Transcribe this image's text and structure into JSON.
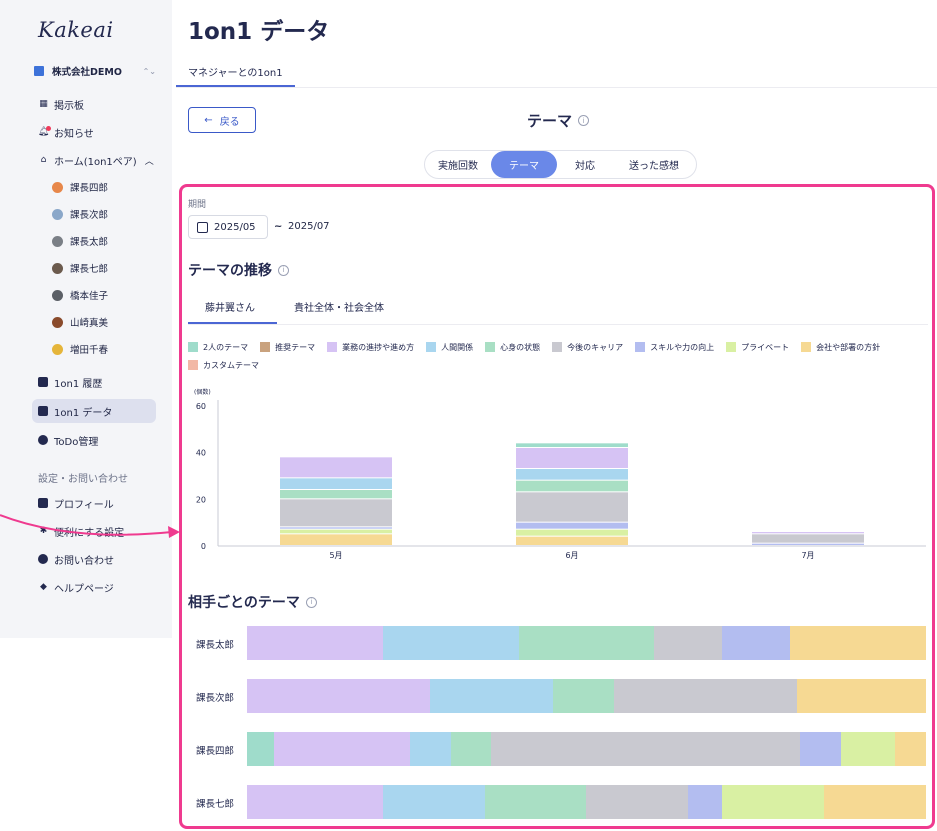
{
  "app": {
    "logo": "Kakeai",
    "company": "株式会社DEMO"
  },
  "sidebar": {
    "items": [
      {
        "label": "掲示板",
        "icon": "bulletin-icon"
      },
      {
        "label": "お知らせ",
        "icon": "bell-icon"
      },
      {
        "label": "ホーム(1on1ペア)",
        "icon": "home-icon"
      }
    ],
    "members": [
      "課長四郎",
      "課長次郎",
      "課長太郎",
      "課長七郎",
      "橋本佳子",
      "山崎真美",
      "増田千春"
    ],
    "items2": [
      {
        "label": "1on1 履歴",
        "icon": "history-icon"
      },
      {
        "label": "1on1 データ",
        "icon": "data-icon"
      },
      {
        "label": "ToDo管理",
        "icon": "check-icon"
      }
    ],
    "settings_label": "設定・お問い合わせ",
    "settings": [
      {
        "label": "プロフィール",
        "icon": "profile-icon"
      },
      {
        "label": "便利にする設定",
        "icon": "gear-icon"
      },
      {
        "label": "お問い合わせ",
        "icon": "help-icon"
      },
      {
        "label": "ヘルプページ",
        "icon": "graduation-icon"
      }
    ]
  },
  "header": {
    "title": "1on1 データ",
    "tab": "マネジャーとの1on1"
  },
  "view": {
    "back_label": "戻る",
    "title": "テーマ",
    "segments": [
      "実施回数",
      "テーマ",
      "対応",
      "送った感想"
    ],
    "active_segment": "テーマ"
  },
  "period": {
    "label": "期間",
    "start": "2025/05",
    "separator": "~",
    "end": "2025/07"
  },
  "trend": {
    "title": "テーマの推移",
    "tabs": [
      "藤井翼さん",
      "貴社全体・社会全体"
    ]
  },
  "colors": {
    "2人のテーマ": "#9fdccb",
    "推奨テーマ": "#c9a27e",
    "業務の進捗や進め方": "#d6c3f4",
    "人間関係": "#a9d6ef",
    "心身の状態": "#a9dfc4",
    "今後のキャリア": "#c9c9d0",
    "スキルや力の向上": "#b3bdf0",
    "プライベート": "#d9f0a3",
    "会社や部署の方針": "#f6d993",
    "カスタムテーマ": "#f2b8a5"
  },
  "chart_data": {
    "type": "bar",
    "stacked": true,
    "ylabel": "(個数)",
    "ylim": [
      0,
      60
    ],
    "yticks": [
      0,
      20,
      40,
      60
    ],
    "categories": [
      "5月",
      "6月",
      "7月"
    ],
    "legend": [
      "2人のテーマ",
      "推奨テーマ",
      "業務の進捗や進め方",
      "人間関係",
      "心身の状態",
      "今後のキャリア",
      "スキルや力の向上",
      "プライベート",
      "会社や部署の方針",
      "カスタムテーマ"
    ],
    "series": [
      {
        "name": "会社や部署の方針",
        "values": [
          5,
          4,
          0
        ]
      },
      {
        "name": "プライベート",
        "values": [
          2,
          3,
          0
        ]
      },
      {
        "name": "スキルや力の向上",
        "values": [
          1,
          3,
          1
        ]
      },
      {
        "name": "今後のキャリア",
        "values": [
          12,
          13,
          4
        ]
      },
      {
        "name": "心身の状態",
        "values": [
          4,
          5,
          0
        ]
      },
      {
        "name": "人間関係",
        "values": [
          5,
          5,
          0
        ]
      },
      {
        "name": "業務の進捗や進め方",
        "values": [
          9,
          9,
          1
        ]
      },
      {
        "name": "2人のテーマ",
        "values": [
          0,
          2,
          0
        ]
      }
    ]
  },
  "by_person": {
    "title": "相手ごとのテーマ",
    "rows": [
      {
        "name": "課長太郎",
        "segments": [
          {
            "theme": "業務の進捗や進め方",
            "share": 0.2
          },
          {
            "theme": "人間関係",
            "share": 0.2
          },
          {
            "theme": "心身の状態",
            "share": 0.2
          },
          {
            "theme": "今後のキャリア",
            "share": 0.1
          },
          {
            "theme": "スキルや力の向上",
            "share": 0.1
          },
          {
            "theme": "会社や部署の方針",
            "share": 0.2
          }
        ]
      },
      {
        "name": "課長次郎",
        "segments": [
          {
            "theme": "業務の進捗や進め方",
            "share": 0.27
          },
          {
            "theme": "人間関係",
            "share": 0.18
          },
          {
            "theme": "心身の状態",
            "share": 0.09
          },
          {
            "theme": "今後のキャリア",
            "share": 0.27
          },
          {
            "theme": "会社や部署の方針",
            "share": 0.19
          }
        ]
      },
      {
        "name": "課長四郎",
        "segments": [
          {
            "theme": "2人のテーマ",
            "share": 0.04
          },
          {
            "theme": "業務の進捗や進め方",
            "share": 0.2
          },
          {
            "theme": "人間関係",
            "share": 0.06
          },
          {
            "theme": "心身の状態",
            "share": 0.06
          },
          {
            "theme": "今後のキャリア",
            "share": 0.455
          },
          {
            "theme": "スキルや力の向上",
            "share": 0.06
          },
          {
            "theme": "プライベート",
            "share": 0.08
          },
          {
            "theme": "会社や部署の方針",
            "share": 0.045
          }
        ]
      },
      {
        "name": "課長七郎",
        "segments": [
          {
            "theme": "業務の進捗や進め方",
            "share": 0.2
          },
          {
            "theme": "人間関係",
            "share": 0.15
          },
          {
            "theme": "心身の状態",
            "share": 0.15
          },
          {
            "theme": "今後のキャリア",
            "share": 0.15
          },
          {
            "theme": "スキルや力の向上",
            "share": 0.05
          },
          {
            "theme": "プライベート",
            "share": 0.15
          },
          {
            "theme": "会社や部署の方針",
            "share": 0.15
          }
        ]
      }
    ]
  }
}
